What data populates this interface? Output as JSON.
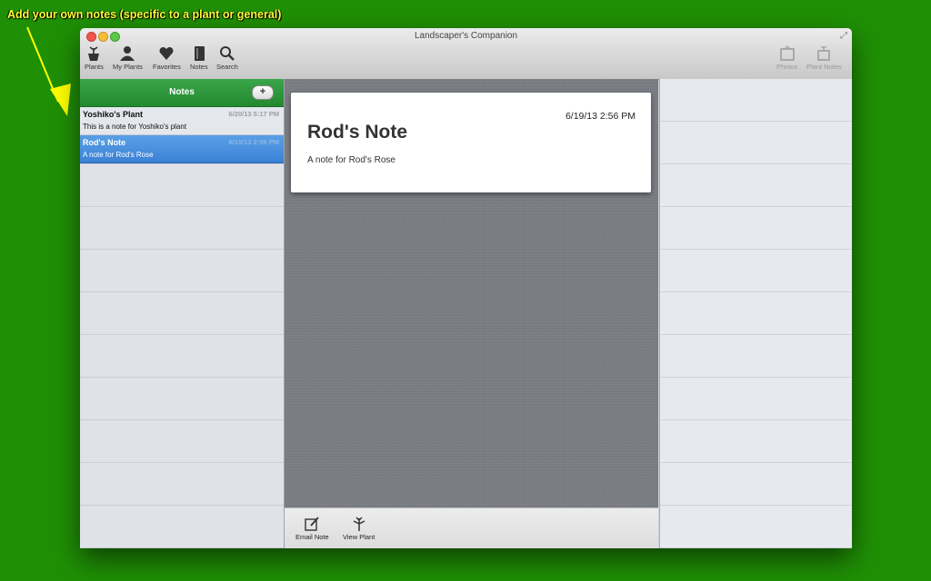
{
  "caption": "Add your own notes (specific to a plant or general)",
  "window": {
    "title": "Landscaper's Companion"
  },
  "toolbar": {
    "plants": "Plants",
    "my_plants": "My Plants",
    "favorites": "Favorites",
    "notes": "Notes",
    "search": "Search",
    "photos": "Photos",
    "plant_notes": "Plant Notes"
  },
  "sidebar": {
    "title": "Notes",
    "add_label": "+",
    "notes": [
      {
        "title": "Yoshiko's Plant",
        "date": "6/20/13 5:17 PM",
        "preview": "This is a note for Yoshiko's plant"
      },
      {
        "title": "Rod's Note",
        "date": "6/19/13 2:56 PM",
        "preview": "A note for Rod's Rose"
      }
    ]
  },
  "note": {
    "date": "6/19/13 2:56 PM",
    "title": "Rod's Note",
    "body": "A note for Rod's Rose"
  },
  "bottom": {
    "email": "Email Note",
    "view_plant": "View Plant"
  },
  "colors": {
    "desktop": "#1f8f05",
    "header_green": "#2e9a3d",
    "selection": "#3b82d6",
    "caption": "#ffff33"
  }
}
